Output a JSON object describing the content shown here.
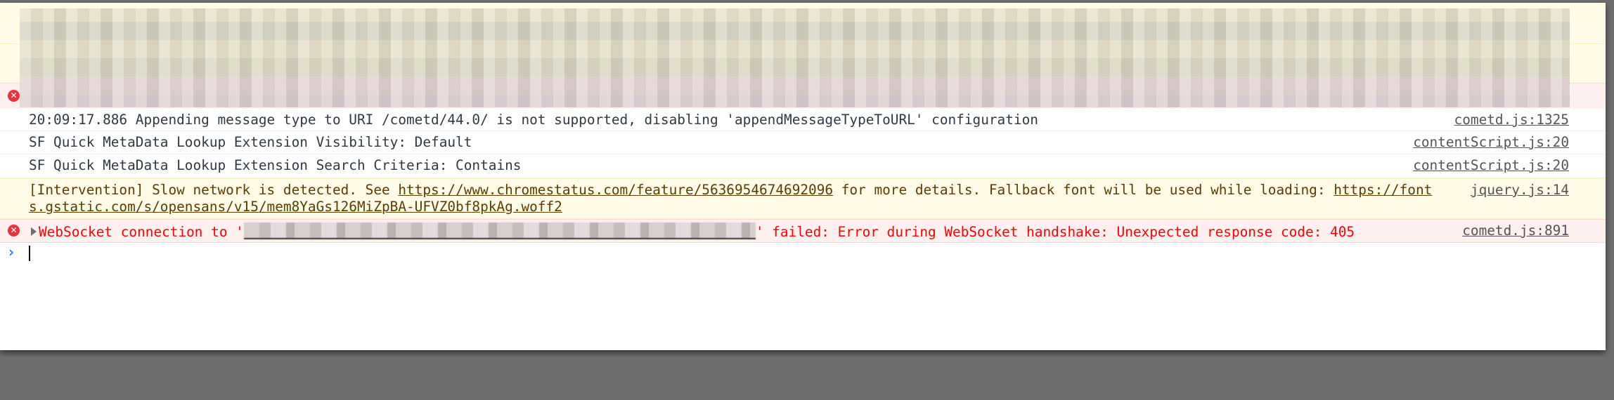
{
  "console": {
    "redacted_entries": [
      {
        "level": "warning",
        "label": "redacted-warning-1"
      },
      {
        "level": "warning",
        "label": "redacted-warning-2"
      },
      {
        "level": "error",
        "label": "redacted-error"
      }
    ],
    "messages": [
      {
        "level": "log",
        "text": "20:09:17.886 Appending message type to URI /cometd/44.0/ is not supported, disabling 'appendMessageTypeToURL' configuration",
        "source": "cometd.js:1325"
      },
      {
        "level": "log",
        "text": "SF Quick MetaData Lookup Extension Visibility: Default",
        "source": "contentScript.js:20"
      },
      {
        "level": "log",
        "text": "SF Quick MetaData Lookup Extension Search Criteria: Contains",
        "source": "contentScript.js:20"
      },
      {
        "level": "warning",
        "text_before_link": "[Intervention] Slow network is detected. See ",
        "link1": "https://www.chromestatus.com/feature/5636954674692096",
        "text_middle": " for more details. Fallback font will be used while loading: ",
        "link2_line1": "https://font",
        "link2_line2": "s.gstatic.com/s/opensans/v15/mem8YaGs126MiZpBA-UFVZ0bf8pkAg.woff2",
        "source": "jquery.js:14"
      },
      {
        "level": "error",
        "text_before": "WebSocket connection to '",
        "redacted_url": "[redacted]",
        "text_after": "' failed: Error during WebSocket handshake: Unexpected response code: 405",
        "source": "cometd.js:891"
      }
    ],
    "prompt_symbol": "›",
    "error_icon_glyph": "✕"
  },
  "colors": {
    "error_text": "#ff0000",
    "warning_text": "#5c3c00",
    "warning_bg": "#fffbe6",
    "error_bg": "#fff0f0",
    "prompt_accent": "#367cf1",
    "error_icon": "#e8323e"
  }
}
